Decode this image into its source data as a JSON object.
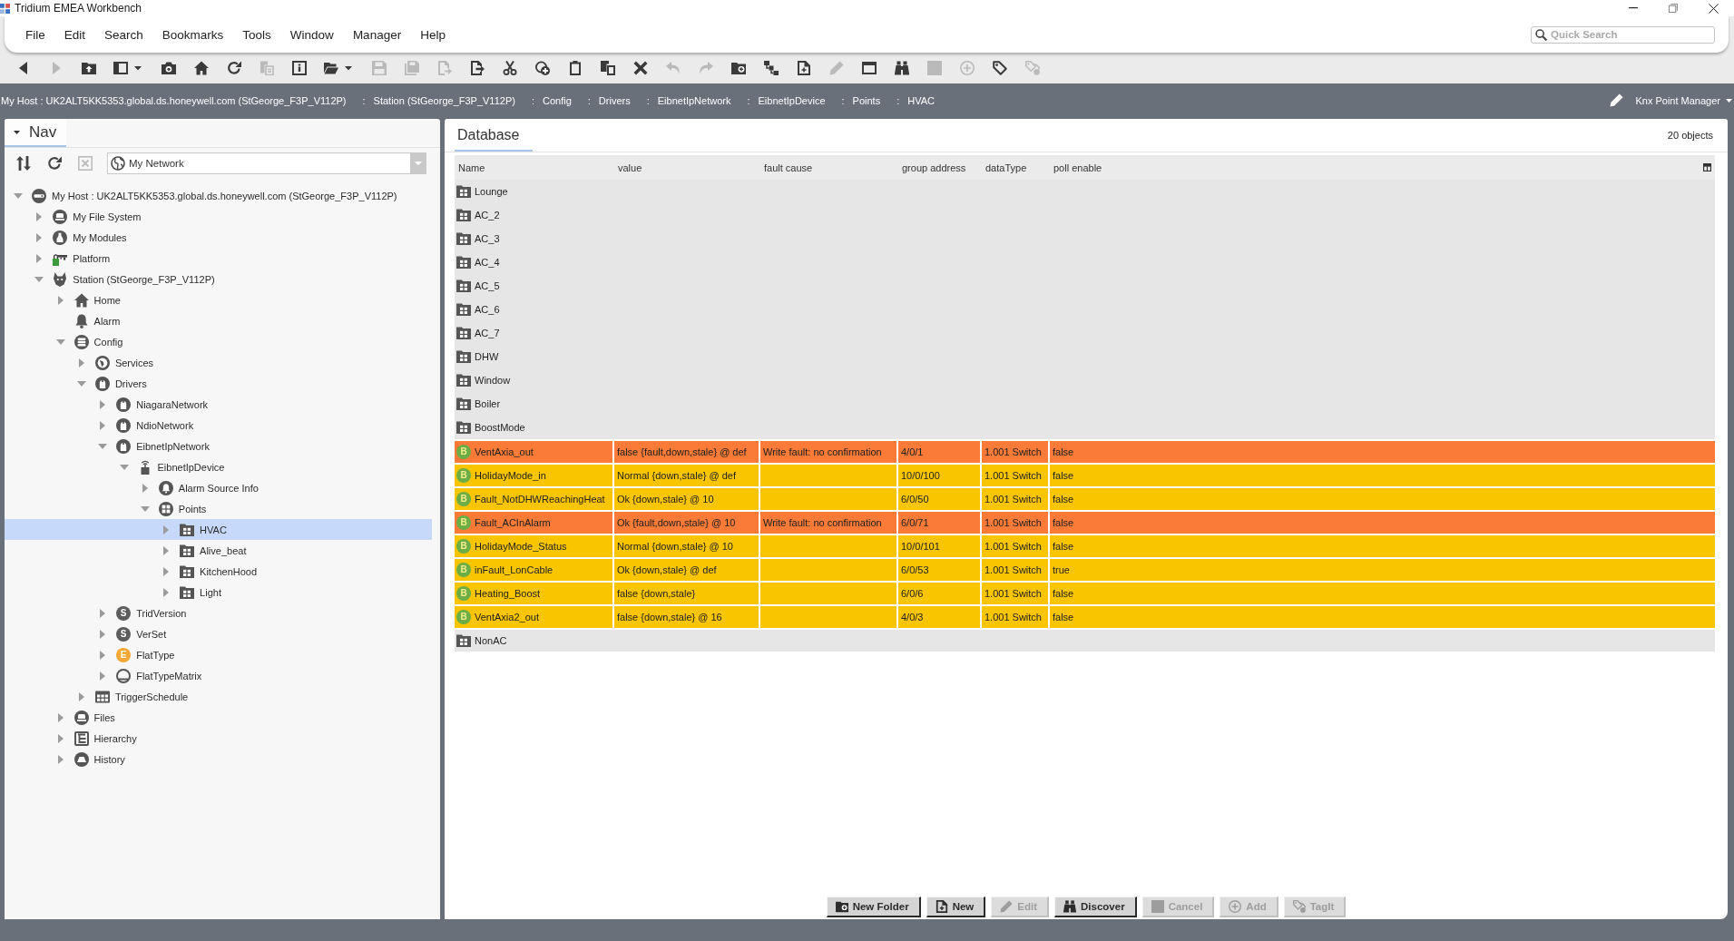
{
  "window": {
    "title": "Tridium EMEA Workbench"
  },
  "menu": [
    "File",
    "Edit",
    "Search",
    "Bookmarks",
    "Tools",
    "Window",
    "Manager",
    "Help"
  ],
  "quick_search": {
    "placeholder": "Quick Search"
  },
  "toolbar": [
    {
      "kind": "back",
      "disabled": false
    },
    {
      "kind": "forward",
      "disabled": true
    },
    {
      "kind": "up",
      "disabled": false
    },
    {
      "kind": "pane",
      "disabled": false
    },
    {
      "kind": "spy",
      "disabled": false
    },
    {
      "kind": "home",
      "disabled": false
    },
    {
      "kind": "refresh",
      "disabled": false
    },
    {
      "kind": "sync",
      "disabled": true
    },
    {
      "kind": "info",
      "disabled": false
    },
    {
      "kind": "open",
      "disabled": false
    },
    {
      "kind": "save",
      "disabled": true
    },
    {
      "kind": "saveall",
      "disabled": true
    },
    {
      "kind": "docarrow",
      "disabled": true
    },
    {
      "kind": "export",
      "disabled": false
    },
    {
      "kind": "cut",
      "disabled": false
    },
    {
      "kind": "addlink",
      "disabled": false
    },
    {
      "kind": "paste",
      "disabled": false
    },
    {
      "kind": "duplicate",
      "disabled": false
    },
    {
      "kind": "delete",
      "disabled": false
    },
    {
      "kind": "undo",
      "disabled": true
    },
    {
      "kind": "redo",
      "disabled": true
    },
    {
      "kind": "newfolder",
      "disabled": false
    },
    {
      "kind": "link",
      "disabled": false
    },
    {
      "kind": "newdoc",
      "disabled": false
    },
    {
      "kind": "edit",
      "disabled": true
    },
    {
      "kind": "window",
      "disabled": false
    },
    {
      "kind": "discover",
      "disabled": false
    },
    {
      "kind": "stop",
      "disabled": true
    },
    {
      "kind": "add",
      "disabled": true
    },
    {
      "kind": "tag",
      "disabled": false
    },
    {
      "kind": "tags",
      "disabled": true
    }
  ],
  "breadcrumbs": [
    {
      "label": "My Host : UK2ALT5KK5353.global.ds.honeywell.com (StGeorge_F3P_V112P)"
    },
    {
      "separator": ":",
      "label": "Station (StGeorge_F3P_V112P)"
    },
    {
      "separator": ":",
      "label": "Config"
    },
    {
      "separator": ":",
      "label": "Drivers"
    },
    {
      "separator": ":",
      "label": "EibnetIpNetwork"
    },
    {
      "separator": ":",
      "label": "EibnetIpDevice"
    },
    {
      "separator": ":",
      "label": "Points"
    },
    {
      "separator": ":",
      "label": "HVAC"
    }
  ],
  "view_selector": {
    "label": "Knx Point Manager"
  },
  "nav": {
    "tabs": [
      {
        "label": "Nav",
        "selected": true
      }
    ],
    "tools": [
      {
        "kind": "sort",
        "disabled": false
      },
      {
        "kind": "refresh",
        "disabled": false
      },
      {
        "kind": "close",
        "disabled": true
      }
    ],
    "selector": {
      "value": "My Network"
    },
    "tree": [
      {
        "label": "My Host : UK2ALT5KK5353.global.ds.honeywell.com (StGeorge_F3P_V112P)",
        "kind": "host",
        "expanded": true,
        "selected": false,
        "children": [
          {
            "label": "My File System",
            "kind": "filesystem",
            "expanded": false,
            "selected": false
          },
          {
            "label": "My Modules",
            "kind": "modules",
            "expanded": false,
            "selected": false
          },
          {
            "label": "Platform",
            "kind": "platform",
            "expanded": false,
            "selected": false
          },
          {
            "label": "Station (StGeorge_F3P_V112P)",
            "kind": "station",
            "expanded": true,
            "selected": false,
            "children": [
              {
                "label": "Home",
                "kind": "home",
                "expanded": false,
                "selected": false
              },
              {
                "label": "Alarm",
                "kind": "alarm",
                "selected": false
              },
              {
                "label": "Config",
                "kind": "config",
                "expanded": true,
                "selected": false,
                "children": [
                  {
                    "label": "Services",
                    "kind": "services",
                    "expanded": false,
                    "selected": false
                  },
                  {
                    "label": "Drivers",
                    "kind": "drivers",
                    "expanded": true,
                    "selected": false,
                    "children": [
                      {
                        "label": "NiagaraNetwork",
                        "kind": "network",
                        "expanded": false,
                        "selected": false
                      },
                      {
                        "label": "NdioNetwork",
                        "kind": "network",
                        "expanded": false,
                        "selected": false
                      },
                      {
                        "label": "EibnetIpNetwork",
                        "kind": "network",
                        "expanded": true,
                        "selected": false,
                        "children": [
                          {
                            "label": "EibnetIpDevice",
                            "kind": "device",
                            "expanded": true,
                            "selected": false,
                            "children": [
                              {
                                "label": "Alarm Source Info",
                                "kind": "alarmsource",
                                "expanded": false,
                                "selected": false
                              },
                              {
                                "label": "Points",
                                "kind": "points",
                                "expanded": true,
                                "selected": false,
                                "children": [
                                  {
                                    "label": "HVAC",
                                    "kind": "folder",
                                    "expanded": false,
                                    "selected": true
                                  },
                                  {
                                    "label": "Alive_beat",
                                    "kind": "folder",
                                    "expanded": false,
                                    "selected": false
                                  },
                                  {
                                    "label": "KitchenHood",
                                    "kind": "folder",
                                    "expanded": false,
                                    "selected": false
                                  },
                                  {
                                    "label": "Light",
                                    "kind": "folder",
                                    "expanded": false,
                                    "selected": false
                                  }
                                ]
                              }
                            ]
                          }
                        ]
                      },
                      {
                        "label": "TridVersion",
                        "kind": "letter",
                        "letter": "S",
                        "color": "#5c5c5c",
                        "expanded": false,
                        "selected": false
                      },
                      {
                        "label": "VerSet",
                        "kind": "letter",
                        "letter": "S",
                        "color": "#5c5c5c",
                        "expanded": false,
                        "selected": false
                      },
                      {
                        "label": "FlatType",
                        "kind": "letter",
                        "letter": "E",
                        "color": "#f6a832",
                        "expanded": false,
                        "selected": false
                      },
                      {
                        "label": "FlatTypeMatrix",
                        "kind": "ring",
                        "expanded": false,
                        "selected": false
                      }
                    ]
                  },
                  {
                    "label": "TriggerSchedule",
                    "kind": "schedule",
                    "expanded": false,
                    "selected": false
                  }
                ]
              },
              {
                "label": "Files",
                "kind": "files",
                "expanded": false,
                "selected": false
              },
              {
                "label": "Hierarchy",
                "kind": "hierarchy",
                "expanded": false,
                "selected": false
              },
              {
                "label": "History",
                "kind": "history",
                "expanded": false,
                "selected": false
              }
            ]
          }
        ]
      }
    ]
  },
  "database": {
    "tabs": [
      {
        "label": "Database",
        "selected": true
      }
    ],
    "count": "20 objects",
    "columns": [
      "Name",
      "value",
      "fault cause",
      "group address",
      "dataType",
      "poll enable"
    ],
    "rows": [
      {
        "kind": "folder",
        "name": "Lounge"
      },
      {
        "kind": "folder",
        "name": "AC_2"
      },
      {
        "kind": "folder",
        "name": "AC_3"
      },
      {
        "kind": "folder",
        "name": "AC_4"
      },
      {
        "kind": "folder",
        "name": "AC_5"
      },
      {
        "kind": "folder",
        "name": "AC_6"
      },
      {
        "kind": "folder",
        "name": "AC_7"
      },
      {
        "kind": "folder",
        "name": "DHW"
      },
      {
        "kind": "folder",
        "name": "Window"
      },
      {
        "kind": "folder",
        "name": "Boiler"
      },
      {
        "kind": "folder",
        "name": "BoostMode"
      },
      {
        "kind": "point",
        "color": "#fa7b38",
        "badge": "B",
        "name": "VentAxia_out",
        "value": "false {fault,down,stale} @ def",
        "fault_cause": "Write fault: no confirmation",
        "group_address": "4/0/1",
        "data_type": "1.001 Switch",
        "poll_enable": "false"
      },
      {
        "kind": "point",
        "color": "#f8c500",
        "badge": "B",
        "name": "HolidayMode_in",
        "value": "Normal {down,stale} @ def",
        "group_address": "10/0/100",
        "data_type": "1.001 Switch",
        "poll_enable": "false"
      },
      {
        "kind": "point",
        "color": "#f8c500",
        "badge": "B",
        "name": "Fault_NotDHWReachingHeat",
        "value": "Ok {down,stale} @ 10",
        "group_address": "6/0/50",
        "data_type": "1.001 Switch",
        "poll_enable": "false"
      },
      {
        "kind": "point",
        "color": "#fa7b38",
        "badge": "B",
        "name": "Fault_ACInAlarm",
        "value": "Ok {fault,down,stale} @ 10",
        "fault_cause": "Write fault: no confirmation",
        "group_address": "6/0/71",
        "data_type": "1.001 Switch",
        "poll_enable": "false"
      },
      {
        "kind": "point",
        "color": "#f8c500",
        "badge": "B",
        "name": "HolidayMode_Status",
        "value": "Normal {down,stale} @ 10",
        "group_address": "10/0/101",
        "data_type": "1.001 Switch",
        "poll_enable": "false"
      },
      {
        "kind": "point",
        "color": "#f8c500",
        "badge": "B",
        "name": "inFault_LonCable",
        "value": "Ok {down,stale} @ def",
        "group_address": "6/0/53",
        "data_type": "1.001 Switch",
        "poll_enable": "true"
      },
      {
        "kind": "point",
        "color": "#f8c500",
        "badge": "B",
        "name": "Heating_Boost",
        "value": "false {down,stale}",
        "group_address": "6/0/6",
        "data_type": "1.001 Switch",
        "poll_enable": "false"
      },
      {
        "kind": "point",
        "color": "#f8c500",
        "badge": "B",
        "name": "VentAxia2_out",
        "value": "false {down,stale} @ 16",
        "group_address": "4/0/3",
        "data_type": "1.001 Switch",
        "poll_enable": "false"
      },
      {
        "kind": "folder",
        "name": "NonAC"
      }
    ],
    "buttons": [
      {
        "kind": "newfolder",
        "label": "New Folder",
        "disabled": false
      },
      {
        "kind": "newdoc",
        "label": "New",
        "disabled": false
      },
      {
        "kind": "edit",
        "label": "Edit",
        "disabled": true
      },
      {
        "kind": "discover",
        "label": "Discover",
        "disabled": false
      },
      {
        "kind": "stop",
        "label": "Cancel",
        "disabled": true
      },
      {
        "kind": "add",
        "label": "Add",
        "disabled": true
      },
      {
        "kind": "tags",
        "label": "TagIt",
        "disabled": true
      }
    ]
  }
}
